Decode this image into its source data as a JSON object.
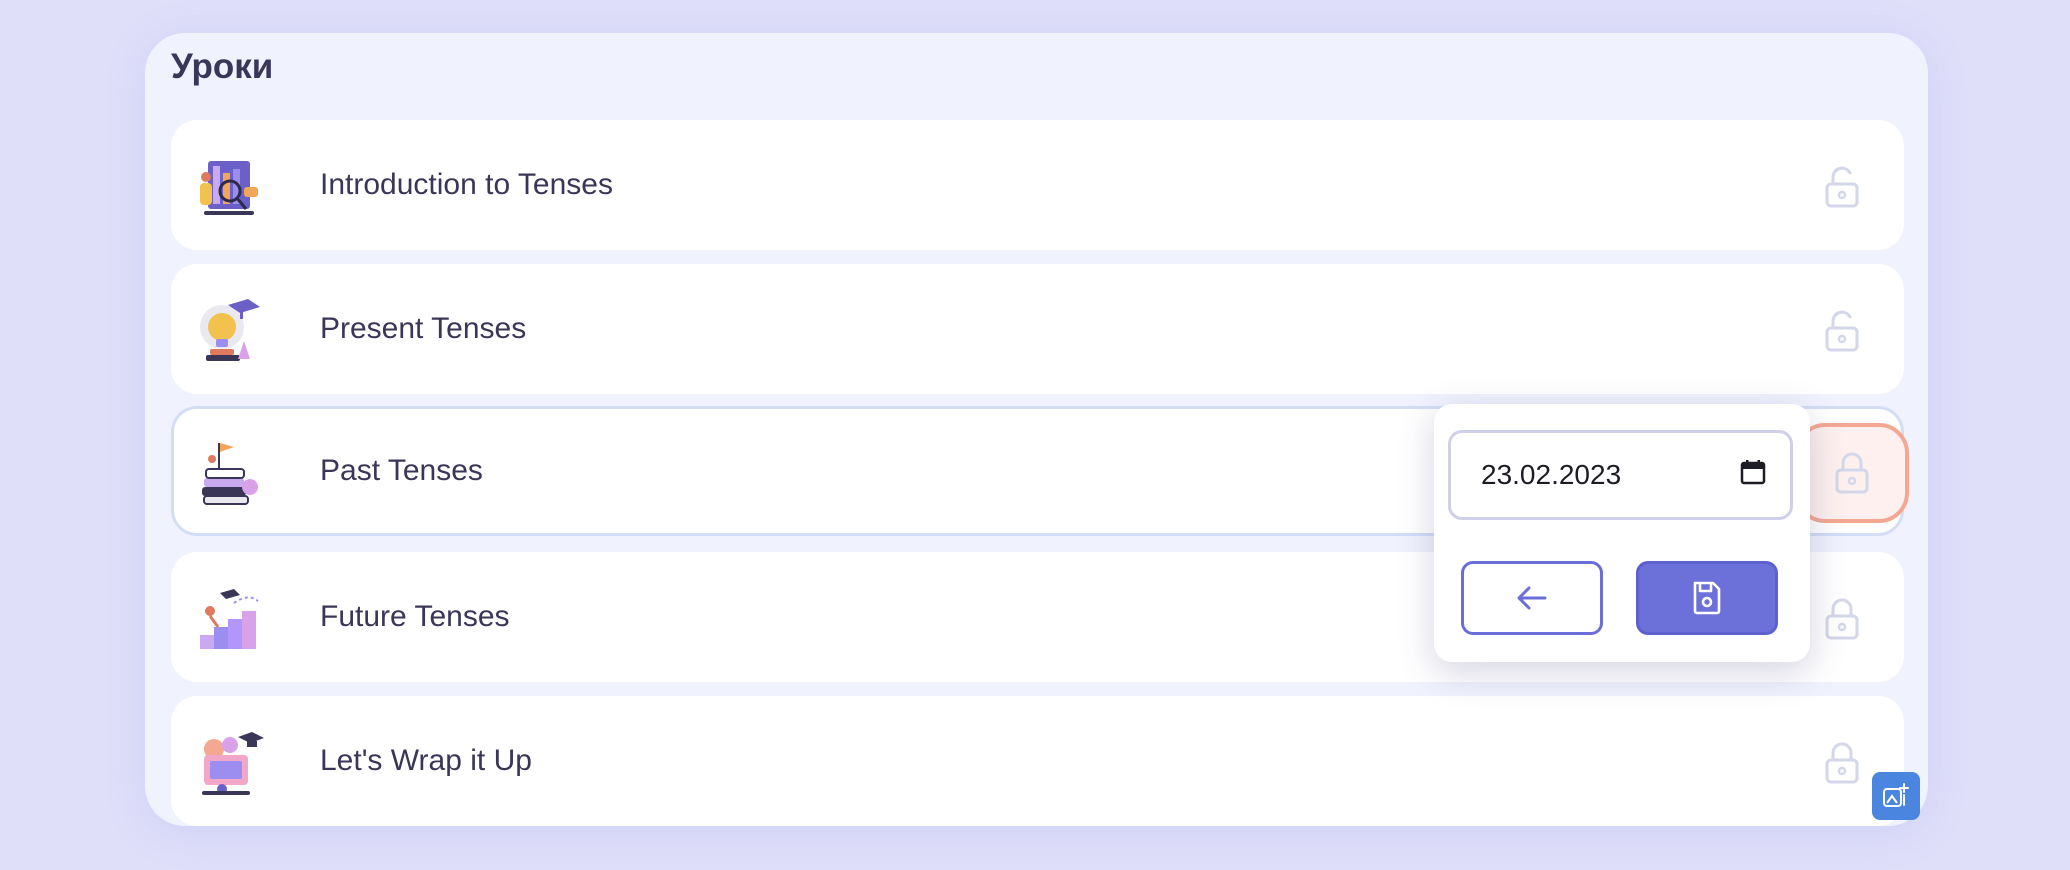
{
  "page": {
    "title": "Уроки"
  },
  "lessons": [
    {
      "name": "Introduction to Tenses",
      "thumbnail": "lesson-illustration-research",
      "lock_icon": "unlocked-padlock-icon"
    },
    {
      "name": "Present Tenses",
      "thumbnail": "lesson-illustration-lightbulb",
      "lock_icon": "unlocked-padlock-icon"
    },
    {
      "name": "Past Tenses",
      "thumbnail": "lesson-illustration-books-flag",
      "lock_icon": "locked-padlock-icon"
    },
    {
      "name": "Future Tenses",
      "thumbnail": "lesson-illustration-stairs-goal",
      "lock_icon": "locked-padlock-icon"
    },
    {
      "name": "Let's Wrap it Up",
      "thumbnail": "lesson-illustration-graduation",
      "lock_icon": "locked-padlock-icon"
    }
  ],
  "date_popup": {
    "date_value": "23.02.2023",
    "calendar_icon": "calendar-icon",
    "back_icon": "arrow-left-icon",
    "save_icon": "save-disk-icon"
  },
  "floating_button": {
    "icon": "image-sparkle-icon"
  },
  "colors": {
    "background": "#dfdffa",
    "panel": "#f0f2fe",
    "accent": "#6c70d9",
    "text": "#3a3658",
    "lock_icon": "#d4d6ea",
    "focus_ring": "#f4a892",
    "fab": "#4a86e0"
  }
}
